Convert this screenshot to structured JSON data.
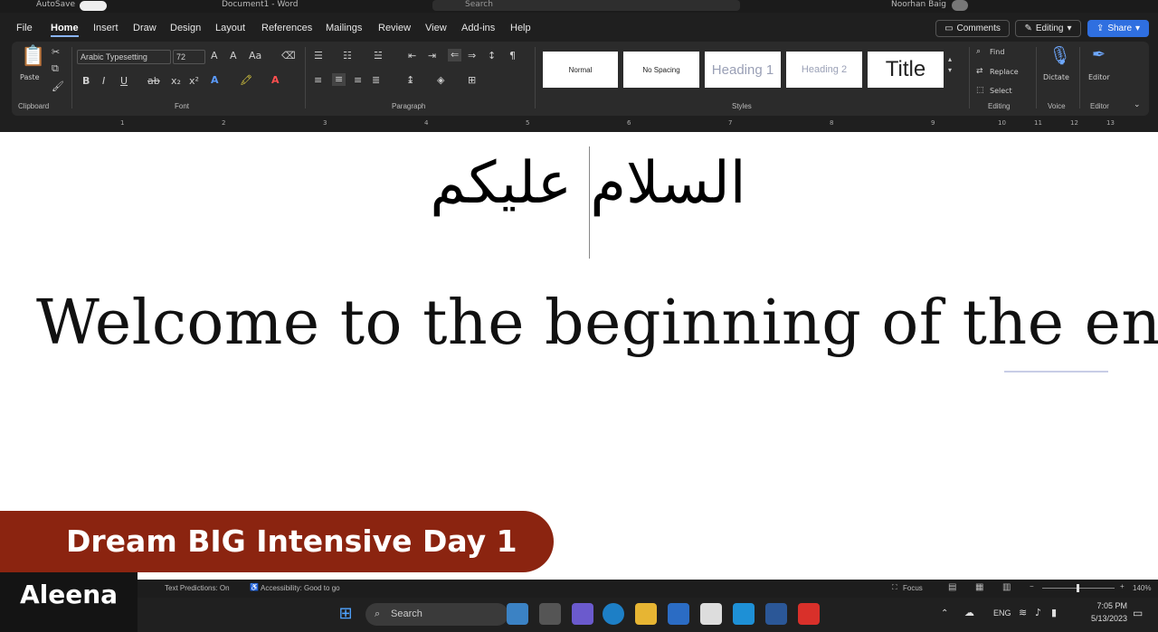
{
  "window": {
    "autosave": "AutoSave",
    "doc_title": "Document1 - Word",
    "search_placeholder": "Search",
    "user": "Noorhan Baig"
  },
  "menu_tabs": [
    "File",
    "Home",
    "Insert",
    "Draw",
    "Design",
    "Layout",
    "References",
    "Mailings",
    "Review",
    "View",
    "Add-ins",
    "Help"
  ],
  "header_buttons": {
    "comments": "Comments",
    "editing": "Editing",
    "share": "Share"
  },
  "ribbon": {
    "paste_label": "Paste",
    "font_name": "Arabic Typesetting",
    "font_size": "72",
    "styles": [
      "Normal",
      "No Spacing",
      "Heading 1",
      "Heading 2",
      "Title"
    ],
    "find": "Find",
    "replace": "Replace",
    "select": "Select",
    "dictate": "Dictate",
    "editor": "Editor",
    "groups": [
      "Clipboard",
      "Font",
      "Paragraph",
      "Styles",
      "Editing",
      "Voice",
      "Editor"
    ]
  },
  "ruler_numbers": [
    "1",
    "2",
    "3",
    "4",
    "5",
    "6",
    "7",
    "8",
    "9",
    "10",
    "11",
    "12",
    "13"
  ],
  "document": {
    "arabic_line": "السلام عليكم",
    "english_line": "Welcome to the beginning of the end"
  },
  "overlay": {
    "banner": "Dream BIG Intensive Day 1",
    "speaker": "Aleena"
  },
  "statusbar": {
    "text_predictions": "Text Predictions: On",
    "accessibility": "Accessibility: Good to go",
    "focus": "Focus",
    "zoom": "140%"
  },
  "taskbar": {
    "search": "Search",
    "language": "ENG",
    "time": "7:05 PM",
    "date": "5/13/2023"
  },
  "colors": {
    "banner_bg": "#8b2410",
    "share_btn": "#2f6fe0",
    "ribbon_bg": "#2b2b2b"
  }
}
